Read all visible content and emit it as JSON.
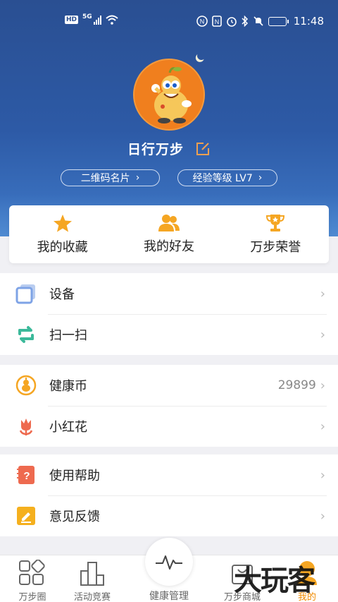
{
  "status_bar": {
    "left_badges": [
      "HD",
      "5G"
    ],
    "time": "11:48",
    "icons": [
      "signal-icon",
      "wifi-icon",
      "nfc-icon",
      "alarm-icon",
      "bluetooth-icon",
      "mute-icon",
      "battery-icon"
    ]
  },
  "profile": {
    "username": "日行万步",
    "qr_card_label": "二维码名片",
    "level_label": "经验等级 LV7",
    "avatar_icon": "gourd-mascot-avatar"
  },
  "quick_actions": [
    {
      "label": "我的收藏",
      "icon": "star-icon"
    },
    {
      "label": "我的好友",
      "icon": "friends-icon"
    },
    {
      "label": "万步荣誉",
      "icon": "trophy-icon"
    }
  ],
  "menu_groups": [
    [
      {
        "label": "设备",
        "icon": "device-icon"
      },
      {
        "label": "扫一扫",
        "icon": "scan-icon"
      }
    ],
    [
      {
        "label": "健康币",
        "icon": "health-coin-icon",
        "value": "29899"
      },
      {
        "label": "小红花",
        "icon": "red-flower-icon"
      }
    ],
    [
      {
        "label": "使用帮助",
        "icon": "help-icon"
      },
      {
        "label": "意见反馈",
        "icon": "feedback-icon"
      }
    ]
  ],
  "tabbar": {
    "tabs": [
      {
        "label": "万步圈",
        "icon": "circle-grid-icon"
      },
      {
        "label": "活动竞赛",
        "icon": "competition-icon"
      },
      {
        "label": "健康管理",
        "icon": "pulse-icon"
      },
      {
        "label": "万步商城",
        "icon": "mall-icon"
      },
      {
        "label": "我的",
        "icon": "me-icon"
      }
    ],
    "active": "我的"
  },
  "watermark": "大玩客",
  "colors": {
    "header_blue": "#2d5aa6",
    "accent_orange": "#f08a00",
    "icon_orange": "#f5a623",
    "icon_teal": "#3bb99a",
    "icon_red": "#ee6a4f"
  }
}
